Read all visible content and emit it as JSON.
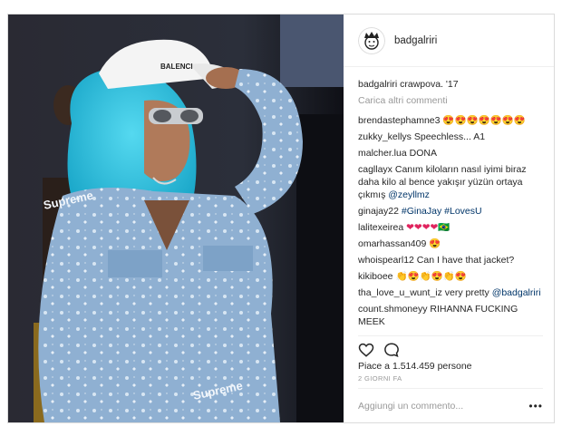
{
  "post": {
    "username": "badgalriri",
    "caption": "badgalriri crawpova. '17",
    "load_more": "Carica altri commenti",
    "comments": [
      {
        "user": "brendastephamne3",
        "text": "😍😍😍😍😍😍😍"
      },
      {
        "user": "zukky_kellys",
        "text": "Speechless... A1"
      },
      {
        "user": "malcher.lua",
        "text": "DONA"
      },
      {
        "user": "cagllayx",
        "text": "Canım kiloların nasıl iyimi biraz daha kilo al bence yakışır yüzün ortaya çıkmış",
        "mention": "@zeyllmz"
      },
      {
        "user": "ginajay22",
        "text": "",
        "mention": "#GinaJay #LovesU"
      },
      {
        "user": "lalitexeirea",
        "text": "❤❤❤❤🇧🇷"
      },
      {
        "user": "omarhassan409",
        "text": "😍"
      },
      {
        "user": "whoispearl12",
        "text": "Can I have that jacket?"
      },
      {
        "user": "kikiboee",
        "text": "👏😍👏😍👏😍"
      },
      {
        "user": "tha_love_u_wunt_iz",
        "text": "very pretty",
        "mention": "@badgalriri"
      },
      {
        "user": "count.shmoneyy",
        "text": "RIHANNA FUCKING MEEK"
      }
    ],
    "likes": "Piace a 1.514.459 persone",
    "time": "2 GIORNI FA",
    "add_comment_placeholder": "Aggiungi un commento...",
    "more_options": "•••",
    "hat_text": "BALENCI",
    "jacket_text": "Supreme"
  },
  "icons": {
    "like": "heart-icon",
    "comment": "comment-bubble-icon",
    "avatar": "avatar-icon"
  }
}
